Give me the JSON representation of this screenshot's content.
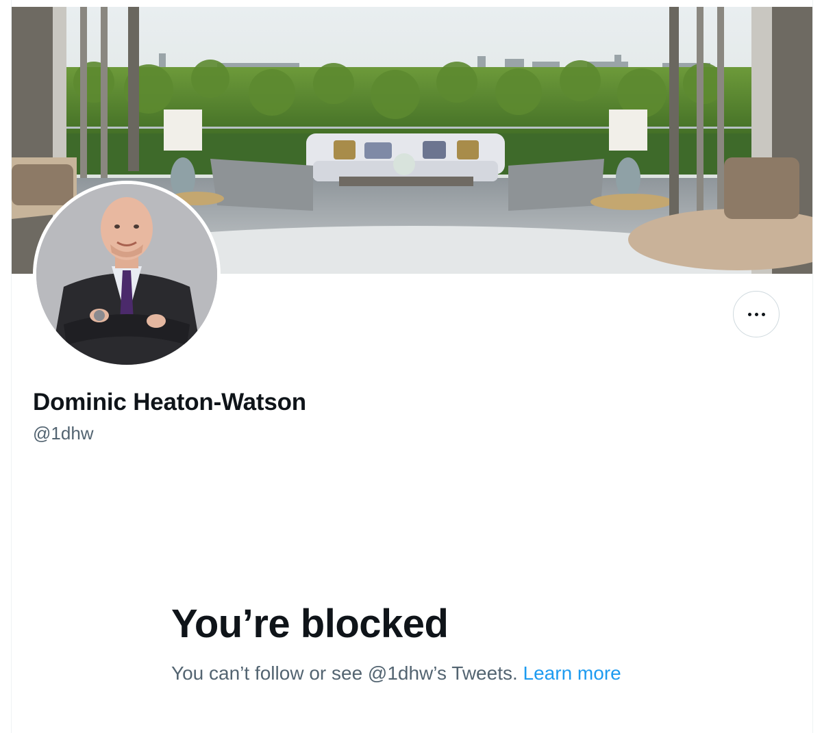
{
  "profile": {
    "display_name": "Dominic Heaton-Watson",
    "handle": "@1dhw"
  },
  "actions": {
    "more_icon": "ellipsis-icon"
  },
  "blocked": {
    "title": "You’re blocked",
    "description": "You can’t follow or see @1dhw’s Tweets.",
    "learn_more": "Learn more"
  },
  "colors": {
    "text_primary": "#0f1419",
    "text_secondary": "#536471",
    "link": "#1d9bf0",
    "border": "#cfd9de"
  }
}
